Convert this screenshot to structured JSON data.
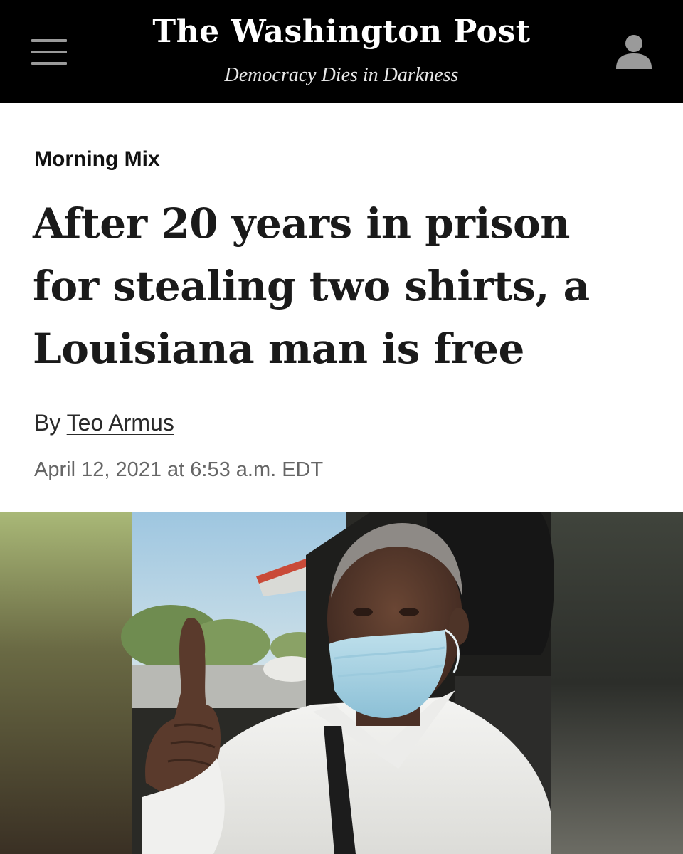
{
  "header": {
    "masthead": "The Washington Post",
    "tagline": "Democracy Dies in Darkness",
    "menu_icon": "hamburger-menu-icon",
    "account_icon": "user-account-icon"
  },
  "article": {
    "kicker": "Morning Mix",
    "headline_lines": [
      "After 20 years in prison",
      "for stealing two shirts, a",
      "Louisiana man is free"
    ],
    "byline_prefix": "By",
    "author": "Teo Armus",
    "date": "April 12, 2021 at 6:53 a.m. EDT"
  },
  "colors": {
    "header_bg": "#000000",
    "masthead_text": "#ffffff",
    "icon_gray": "#9a9a9a",
    "headline_text": "#1a1a1a",
    "date_text": "#666666"
  }
}
